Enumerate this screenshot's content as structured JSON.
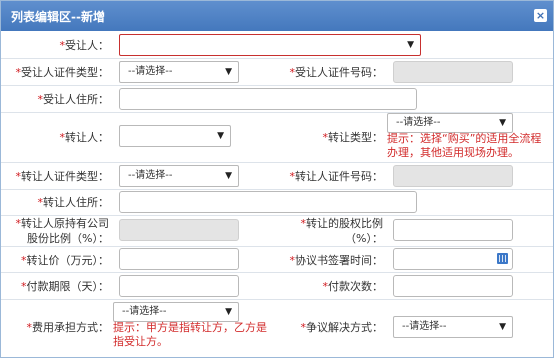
{
  "window": {
    "title": "列表编辑区--新增"
  },
  "req_mark": "*",
  "select_placeholder": "--请选择--",
  "fields": {
    "transferee": "受让人：",
    "transferee_id_type": "受让人证件类型：",
    "transferee_id_no": "受让人证件号码：",
    "transferee_address": "受让人住所：",
    "transferor": "转让人：",
    "transfer_type": "转让类型：",
    "transfer_type_hint": "提示：选择“购买”的适用全流程办理，其他适用现场办理。",
    "transferor_id_type": "转让人证件类型：",
    "transferor_id_no": "转让人证件号码：",
    "transferor_address": "转让人住所：",
    "orig_share_ratio": "转让人原持有公司股份比例（%）：",
    "equity_ratio": "转让的股权比例（%）：",
    "price": "转让价（万元）：",
    "agreement_time": "协议书签署时间：",
    "payment_term": "付款期限（天）：",
    "payment_count": "付款次数：",
    "fee_method": "费用承担方式：",
    "fee_method_hint": "提示：甲方是指转让方，乙方是指受让方。",
    "dispute_method": "争议解决方式："
  }
}
